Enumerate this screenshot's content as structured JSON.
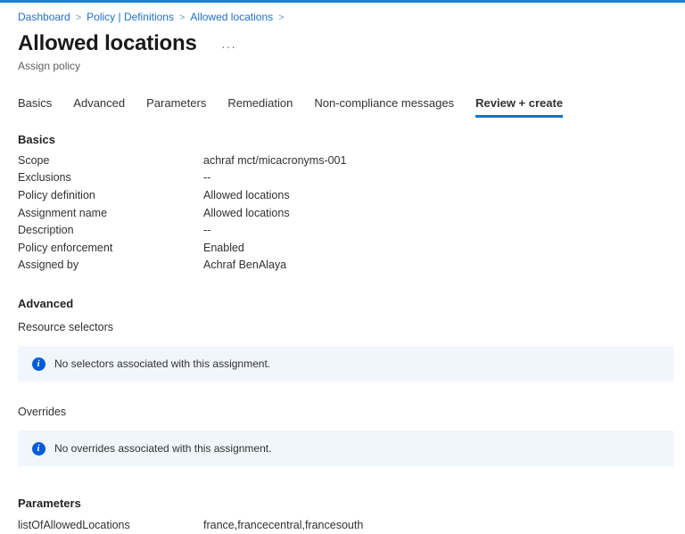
{
  "colors": {
    "topbar": "#1e7fd4",
    "link": "#2071c7",
    "accent": "#0078d4",
    "info": "#015cda",
    "banner-bg": "#f0f6fc"
  },
  "breadcrumb": {
    "separator": ">",
    "items": [
      "Dashboard",
      "Policy | Definitions",
      "Allowed locations"
    ]
  },
  "header": {
    "title": "Allowed locations",
    "more_label": "...",
    "subtitle": "Assign policy"
  },
  "tabs": [
    {
      "label": "Basics",
      "active": false
    },
    {
      "label": "Advanced",
      "active": false
    },
    {
      "label": "Parameters",
      "active": false
    },
    {
      "label": "Remediation",
      "active": false
    },
    {
      "label": "Non-compliance messages",
      "active": false
    },
    {
      "label": "Review + create",
      "active": true
    }
  ],
  "icons": {
    "info_glyph": "i"
  },
  "sections": {
    "basics": {
      "heading": "Basics",
      "rows": [
        {
          "label": "Scope",
          "value": "achraf mct/micacronyms-001"
        },
        {
          "label": "Exclusions",
          "value": "--"
        },
        {
          "label": "Policy definition",
          "value": "Allowed locations"
        },
        {
          "label": "Assignment name",
          "value": "Allowed locations"
        },
        {
          "label": "Description",
          "value": "--"
        },
        {
          "label": "Policy enforcement",
          "value": "Enabled"
        },
        {
          "label": "Assigned by",
          "value": "Achraf BenAlaya"
        }
      ]
    },
    "advanced": {
      "heading": "Advanced",
      "resource_selectors_label": "Resource selectors",
      "selectors_banner": "No selectors associated with this assignment.",
      "overrides_label": "Overrides",
      "overrides_banner": "No overrides associated with this assignment."
    },
    "parameters": {
      "heading": "Parameters",
      "rows": [
        {
          "label": "listOfAllowedLocations",
          "value": "france,francecentral,francesouth"
        }
      ]
    }
  }
}
